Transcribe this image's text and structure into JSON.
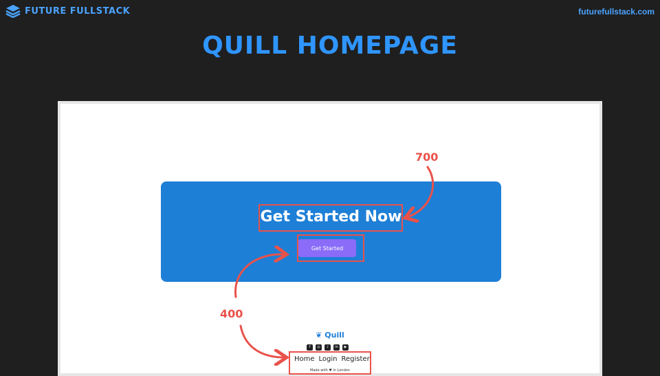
{
  "header": {
    "brand": "FUTURE FULLSTACK",
    "url": "futurefullstack.com",
    "title": "QUILL HOMEPAGE"
  },
  "screenshot": {
    "cta": {
      "heading": "Get Started Now",
      "button_label": "Get Started"
    },
    "footer": {
      "logo_text": "Quill",
      "social_icons": [
        "facebook-icon",
        "instagram-icon",
        "tiktok-icon",
        "linkedin-icon",
        "youtube-icon"
      ],
      "links": [
        "Home",
        "Login",
        "Register"
      ],
      "made_with": "Made with ♥ in London"
    }
  },
  "annotations": {
    "heading_weight": "700",
    "body_weight": "400"
  },
  "colors": {
    "background": "#1f1f1f",
    "accent": "#2f95ff",
    "cta_blue": "#1e7fd6",
    "button_purple": "#8a6cf8",
    "annotation_red": "#e9524a"
  }
}
